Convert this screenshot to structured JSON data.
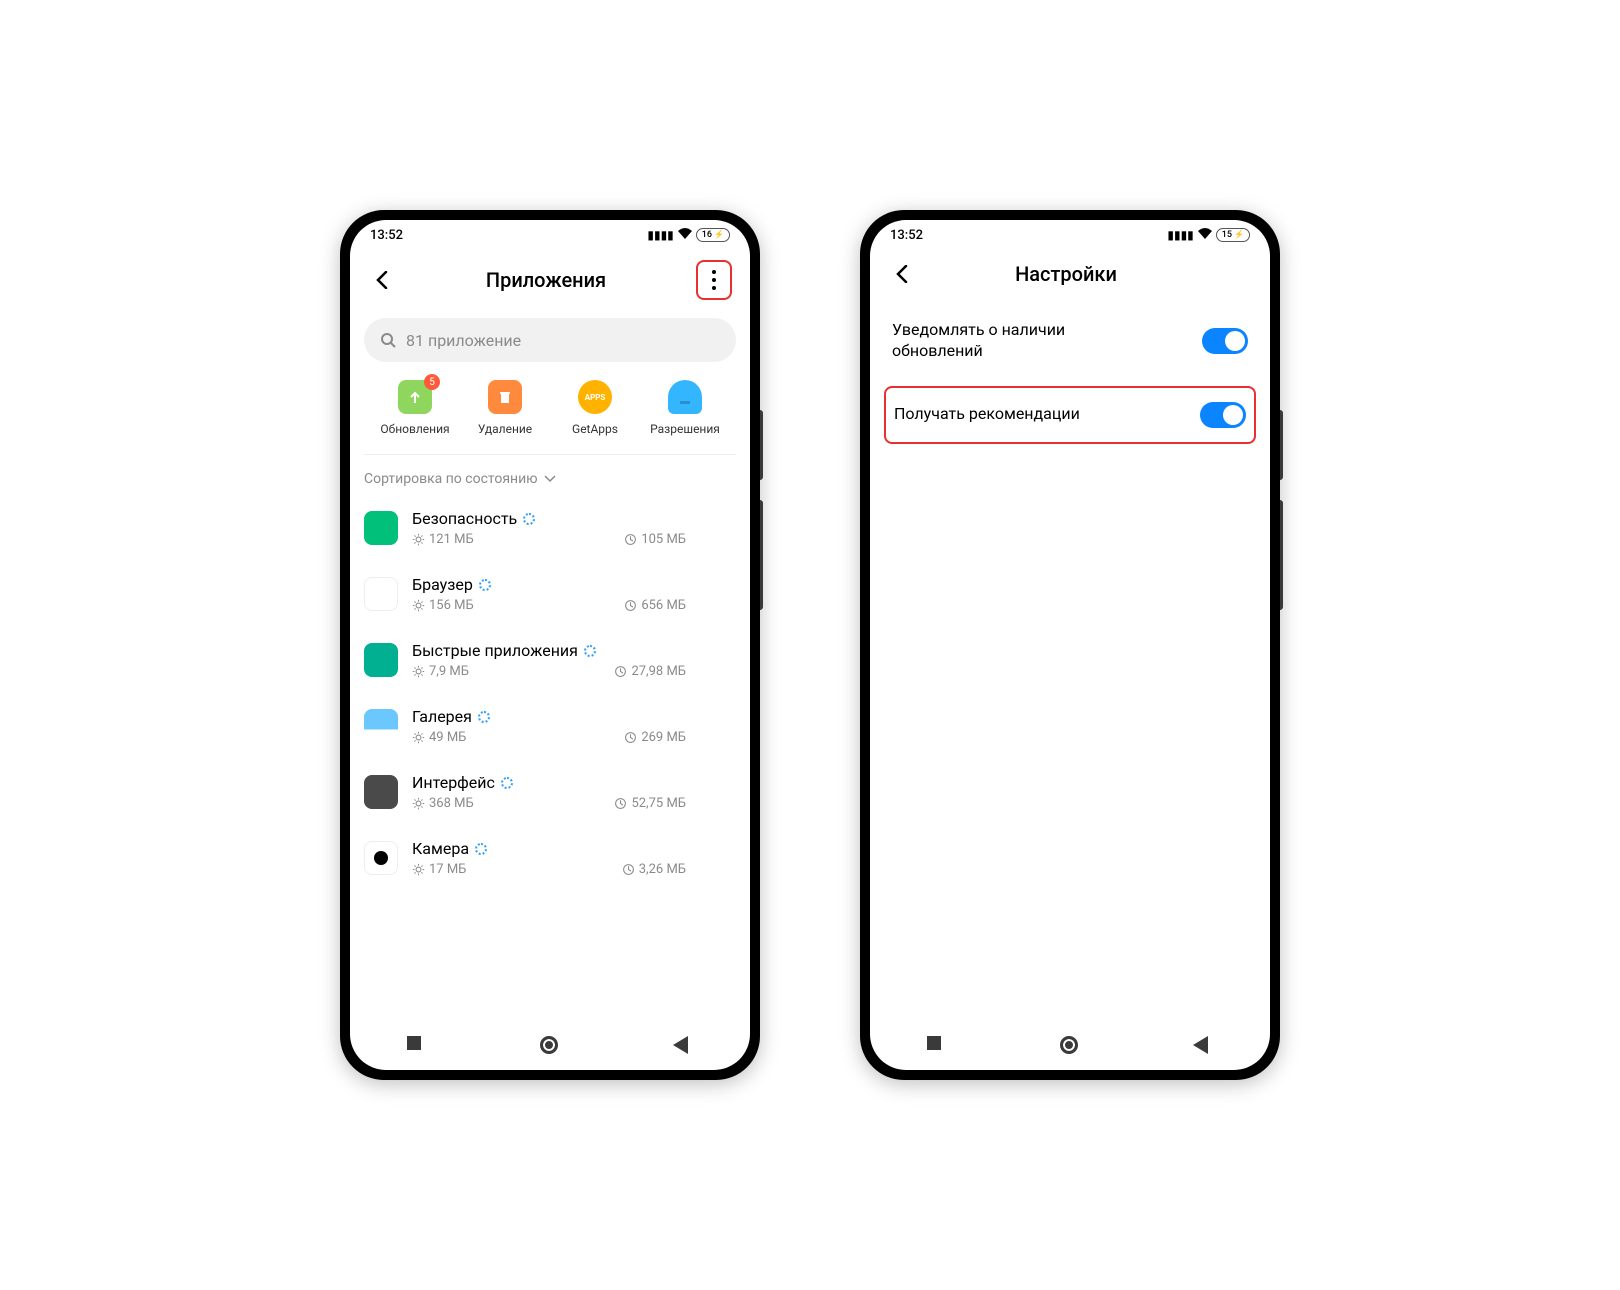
{
  "status": {
    "time": "13:52",
    "battery_left": "16",
    "battery_right": "15"
  },
  "screen1": {
    "title": "Приложения",
    "search_placeholder": "81 приложение",
    "quick": [
      {
        "label": "Обновления",
        "badge": "5"
      },
      {
        "label": "Удаление"
      },
      {
        "label": "GetApps"
      },
      {
        "label": "Разрешения"
      }
    ],
    "sort_label": "Сортировка по состоянию",
    "apps": [
      {
        "name": "Безопасность",
        "storage": "121 МБ",
        "data": "105 МБ",
        "icon": "ic-security"
      },
      {
        "name": "Браузер",
        "storage": "156 МБ",
        "data": "656 МБ",
        "icon": "ic-browser"
      },
      {
        "name": "Быстрые приложения",
        "storage": "7,9 МБ",
        "data": "27,98 МБ",
        "icon": "ic-quick"
      },
      {
        "name": "Галерея",
        "storage": "49 МБ",
        "data": "269 МБ",
        "icon": "ic-gallery"
      },
      {
        "name": "Интерфейс",
        "storage": "368 МБ",
        "data": "52,75 МБ",
        "icon": "ic-interface"
      },
      {
        "name": "Камера",
        "storage": "17 МБ",
        "data": "3,26 МБ",
        "icon": "ic-camera"
      }
    ]
  },
  "screen2": {
    "title": "Настройки",
    "settings": [
      {
        "label": "Уведомлять о наличии обновлений",
        "on": true,
        "highlighted": false
      },
      {
        "label": "Получать рекомендации",
        "on": true,
        "highlighted": true
      }
    ]
  }
}
